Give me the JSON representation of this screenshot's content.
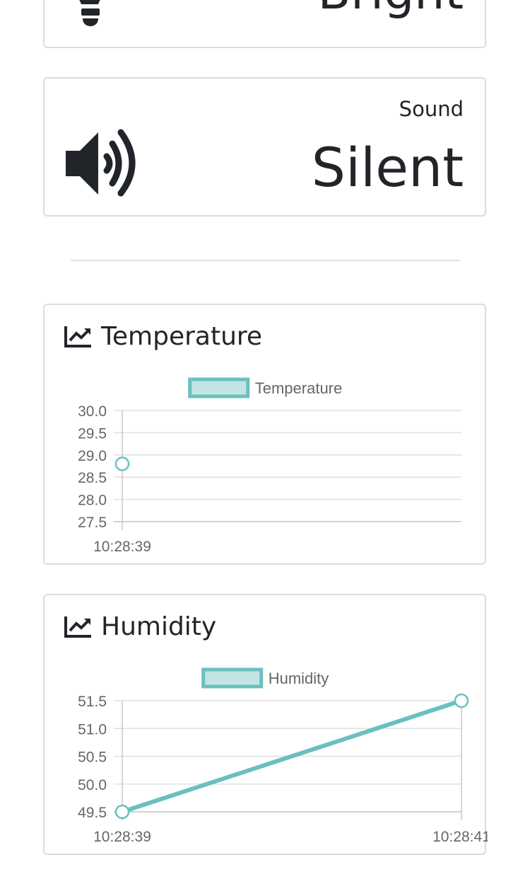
{
  "light": {
    "value": "Bright",
    "icon": "lightbulb-icon"
  },
  "sound": {
    "label": "Sound",
    "value": "Silent",
    "icon": "speaker-volume-icon"
  },
  "temperature": {
    "title": "Temperature",
    "icon": "chart-line-icon"
  },
  "humidity": {
    "title": "Humidity",
    "icon": "chart-line-icon"
  },
  "colors": {
    "line": "#6bbfbf",
    "fill": "#c3e4e4",
    "grid": "#e0e0e0",
    "axis": "#c8c8c8",
    "tick": "#666666"
  },
  "chart_data": [
    {
      "type": "line",
      "title": "",
      "legend": "top",
      "x": [
        "10:28:39"
      ],
      "series": [
        {
          "name": "Temperature",
          "values": [
            28.8
          ]
        }
      ],
      "yticks": [
        "30.0",
        "29.5",
        "29.0",
        "28.5",
        "28.0",
        "27.5"
      ],
      "ylim": [
        27.5,
        30.0
      ],
      "grid": true
    },
    {
      "type": "line",
      "title": "",
      "legend": "top",
      "x": [
        "10:28:39",
        "10:28:41"
      ],
      "series": [
        {
          "name": "Humidity",
          "values": [
            49.5,
            51.5
          ]
        }
      ],
      "yticks": [
        "51.5",
        "51.0",
        "50.5",
        "50.0",
        "49.5"
      ],
      "ylim": [
        49.5,
        51.5
      ],
      "grid": true
    }
  ]
}
